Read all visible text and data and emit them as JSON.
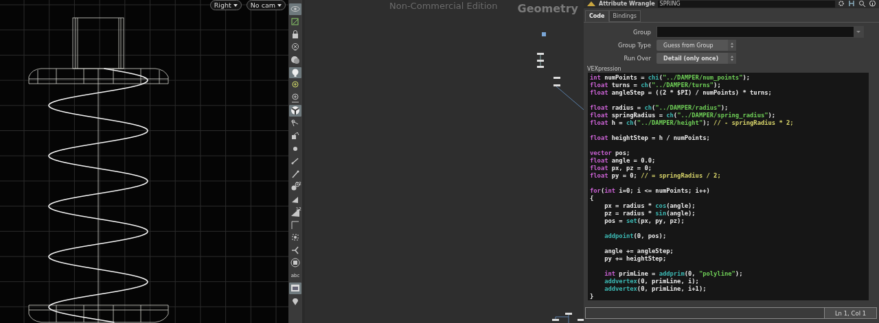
{
  "viewport": {
    "view_menu": "Right",
    "camera_menu": "No cam"
  },
  "toolbar": [
    {
      "selected": true
    },
    {
      "selected": false
    },
    {
      "selected": false
    },
    {
      "selected": false
    },
    {
      "selected": false
    },
    {
      "selected": true
    },
    {
      "selected": false
    },
    {
      "selected": false
    },
    {
      "selected": true
    },
    {
      "selected": false
    },
    {
      "selected": false
    },
    {
      "selected": false
    },
    {
      "selected": false
    },
    {
      "selected": false
    },
    {
      "selected": false,
      "label": "12"
    },
    {
      "selected": false
    },
    {
      "selected": false,
      "label": "12"
    },
    {
      "selected": false
    },
    {
      "selected": false
    },
    {
      "selected": false
    },
    {
      "selected": false
    },
    {
      "selected": false,
      "label": "abc"
    },
    {
      "selected": true
    },
    {
      "selected": false
    }
  ],
  "network": {
    "edition": "Non-Commercial Edition",
    "context": "Geometry"
  },
  "parameters": {
    "node_type": "Attribute Wrangle",
    "node_name": "SPRING",
    "tabs": [
      {
        "label": "Code",
        "selected": true
      },
      {
        "label": "Bindings",
        "selected": false
      }
    ],
    "fields": [
      {
        "kind": "text",
        "label": "Group"
      },
      {
        "kind": "menu",
        "label": "Group Type",
        "value": "Guess from Group"
      },
      {
        "kind": "menu",
        "label": "Run Over",
        "value": "Detail (only once)"
      }
    ],
    "code_label": "VEXpression",
    "code": [
      {
        "kind": "code",
        "indented": false,
        "tokens": [
          {
            "kind": "keyword",
            "text": "int"
          },
          {
            "kind": "plain",
            "text": " numPoints = "
          },
          {
            "kind": "function",
            "text": "chi"
          },
          {
            "kind": "plain",
            "text": "("
          },
          {
            "kind": "string",
            "text": "\"../DAMPER/num_points\""
          },
          {
            "kind": "plain",
            "text": ");"
          }
        ]
      },
      {
        "kind": "code",
        "indented": false,
        "tokens": [
          {
            "kind": "keyword",
            "text": "float"
          },
          {
            "kind": "plain",
            "text": " turns = "
          },
          {
            "kind": "function",
            "text": "ch"
          },
          {
            "kind": "plain",
            "text": "("
          },
          {
            "kind": "string",
            "text": "\"../DAMPER/turns\""
          },
          {
            "kind": "plain",
            "text": ");"
          }
        ]
      },
      {
        "kind": "code",
        "indented": false,
        "tokens": [
          {
            "kind": "keyword",
            "text": "float"
          },
          {
            "kind": "plain",
            "text": " angleStep = ((2 * $PI) / numPoints) * turns;"
          }
        ]
      },
      {
        "kind": "blank"
      },
      {
        "kind": "code",
        "indented": false,
        "tokens": [
          {
            "kind": "keyword",
            "text": "float"
          },
          {
            "kind": "plain",
            "text": " radius = "
          },
          {
            "kind": "function",
            "text": "ch"
          },
          {
            "kind": "plain",
            "text": "("
          },
          {
            "kind": "string",
            "text": "\"../DAMPER/radius\""
          },
          {
            "kind": "plain",
            "text": ");"
          }
        ]
      },
      {
        "kind": "code",
        "indented": false,
        "tokens": [
          {
            "kind": "keyword",
            "text": "float"
          },
          {
            "kind": "plain",
            "text": " springRadius = "
          },
          {
            "kind": "function",
            "text": "ch"
          },
          {
            "kind": "plain",
            "text": "("
          },
          {
            "kind": "string",
            "text": "\"../DAMPER/spring_radius\""
          },
          {
            "kind": "plain",
            "text": ");"
          }
        ]
      },
      {
        "kind": "code",
        "indented": false,
        "tokens": [
          {
            "kind": "keyword",
            "text": "float"
          },
          {
            "kind": "plain",
            "text": " h = "
          },
          {
            "kind": "function",
            "text": "ch"
          },
          {
            "kind": "plain",
            "text": "("
          },
          {
            "kind": "string",
            "text": "\"../DAMPER/height\""
          },
          {
            "kind": "plain",
            "text": "); "
          },
          {
            "kind": "comment",
            "text": "// - springRadius * 2;"
          }
        ]
      },
      {
        "kind": "blank"
      },
      {
        "kind": "code",
        "indented": false,
        "tokens": [
          {
            "kind": "keyword",
            "text": "float"
          },
          {
            "kind": "plain",
            "text": " heightStep = h / numPoints;"
          }
        ]
      },
      {
        "kind": "blank"
      },
      {
        "kind": "code",
        "indented": false,
        "tokens": [
          {
            "kind": "keyword",
            "text": "vector"
          },
          {
            "kind": "plain",
            "text": " pos;"
          }
        ]
      },
      {
        "kind": "code",
        "indented": false,
        "tokens": [
          {
            "kind": "keyword",
            "text": "float"
          },
          {
            "kind": "plain",
            "text": " angle = 0.0;"
          }
        ]
      },
      {
        "kind": "code",
        "indented": false,
        "tokens": [
          {
            "kind": "keyword",
            "text": "float"
          },
          {
            "kind": "plain",
            "text": " px, pz = 0;"
          }
        ]
      },
      {
        "kind": "code",
        "indented": false,
        "tokens": [
          {
            "kind": "keyword",
            "text": "float"
          },
          {
            "kind": "plain",
            "text": " py = 0; "
          },
          {
            "kind": "comment",
            "text": "// = springRadius / 2;"
          }
        ]
      },
      {
        "kind": "blank"
      },
      {
        "kind": "code",
        "indented": false,
        "tokens": [
          {
            "kind": "keyword",
            "text": "for"
          },
          {
            "kind": "plain",
            "text": "("
          },
          {
            "kind": "keyword",
            "text": "int"
          },
          {
            "kind": "plain",
            "text": " i=0; i <= numPoints; i++)"
          }
        ]
      },
      {
        "kind": "code",
        "indented": false,
        "tokens": [
          {
            "kind": "plain",
            "text": "{"
          }
        ]
      },
      {
        "kind": "code",
        "indented": true,
        "tokens": [
          {
            "kind": "plain",
            "text": "px = radius * "
          },
          {
            "kind": "function",
            "text": "cos"
          },
          {
            "kind": "plain",
            "text": "(angle);"
          }
        ]
      },
      {
        "kind": "code",
        "indented": true,
        "tokens": [
          {
            "kind": "plain",
            "text": "pz = radius * "
          },
          {
            "kind": "function",
            "text": "sin"
          },
          {
            "kind": "plain",
            "text": "(angle);"
          }
        ]
      },
      {
        "kind": "code",
        "indented": true,
        "tokens": [
          {
            "kind": "plain",
            "text": "pos = "
          },
          {
            "kind": "function",
            "text": "set"
          },
          {
            "kind": "plain",
            "text": "(px, py, pz);"
          }
        ]
      },
      {
        "kind": "blank"
      },
      {
        "kind": "code",
        "indented": true,
        "tokens": [
          {
            "kind": "function",
            "text": "addpoint"
          },
          {
            "kind": "plain",
            "text": "(0, pos);"
          }
        ]
      },
      {
        "kind": "blank"
      },
      {
        "kind": "code",
        "indented": true,
        "tokens": [
          {
            "kind": "plain",
            "text": "angle += angleStep;"
          }
        ]
      },
      {
        "kind": "code",
        "indented": true,
        "tokens": [
          {
            "kind": "plain",
            "text": "py += heightStep;"
          }
        ]
      },
      {
        "kind": "blank"
      },
      {
        "kind": "code",
        "indented": true,
        "tokens": [
          {
            "kind": "keyword",
            "text": "int"
          },
          {
            "kind": "plain",
            "text": " primLine = "
          },
          {
            "kind": "function",
            "text": "addprim"
          },
          {
            "kind": "plain",
            "text": "(0, "
          },
          {
            "kind": "string",
            "text": "\"polyline\""
          },
          {
            "kind": "plain",
            "text": ");"
          }
        ]
      },
      {
        "kind": "code",
        "indented": true,
        "tokens": [
          {
            "kind": "function",
            "text": "addvertex"
          },
          {
            "kind": "plain",
            "text": "(0, primLine, i);"
          }
        ]
      },
      {
        "kind": "code",
        "indented": true,
        "tokens": [
          {
            "kind": "function",
            "text": "addvertex"
          },
          {
            "kind": "plain",
            "text": "(0, primLine, i+1);"
          }
        ]
      },
      {
        "kind": "code",
        "indented": false,
        "tokens": [
          {
            "kind": "plain",
            "text": "}"
          }
        ]
      }
    ],
    "cursor_position": "Ln 1, Col 1"
  }
}
